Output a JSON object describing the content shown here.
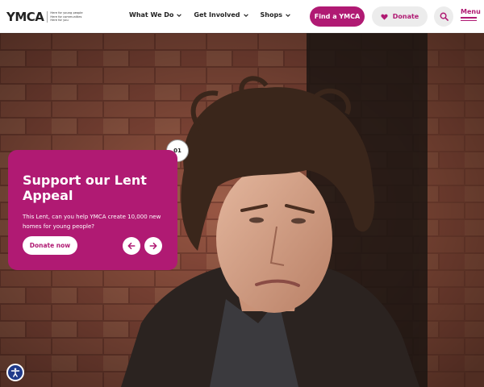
{
  "header": {
    "logo_text": "YMCA",
    "tagline": [
      "Here for young people",
      "Here for communities",
      "Here for you"
    ],
    "nav": [
      {
        "label": "What We Do"
      },
      {
        "label": "Get Involved"
      },
      {
        "label": "Shops"
      }
    ],
    "find_label": "Find a YMCA",
    "donate_label": "Donate",
    "menu_label": "Menu"
  },
  "hero": {
    "slide_number": "01",
    "title": "Support our Lent Appeal",
    "body": "This Lent, can you help YMCA create 10,000 new homes for young people?",
    "cta_label": "Donate now"
  },
  "colors": {
    "brand": "#b01a73",
    "accessibility": "#1f3a8a"
  },
  "icons": [
    "chevron-down-icon",
    "heart-icon",
    "search-icon",
    "menu-icon",
    "arrow-left-icon",
    "arrow-right-icon",
    "accessibility-icon"
  ]
}
